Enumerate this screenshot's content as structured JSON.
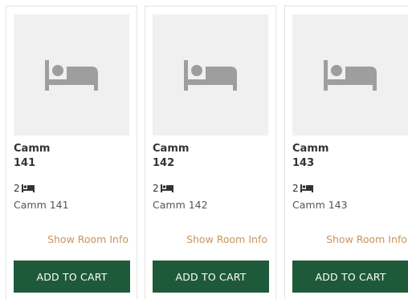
{
  "rooms": [
    {
      "type": "Camm",
      "number": "141",
      "beds": "2",
      "description": "Camm 141",
      "info_link": "Show Room Info",
      "cart_label": "ADD TO CART"
    },
    {
      "type": "Camm",
      "number": "142",
      "beds": "2",
      "description": "Camm 142",
      "info_link": "Show Room Info",
      "cart_label": "ADD TO CART"
    },
    {
      "type": "Camm",
      "number": "143",
      "beds": "2",
      "description": "Camm 143",
      "info_link": "Show Room Info",
      "cart_label": "ADD TO CART"
    }
  ],
  "icons": {
    "placeholder": "bed-icon",
    "beds": "bed-icon"
  },
  "colors": {
    "button": "#1e5a3a",
    "link": "#c8955a",
    "placeholder_bg": "#f0f0f0",
    "placeholder_icon": "#9e9e9e"
  }
}
